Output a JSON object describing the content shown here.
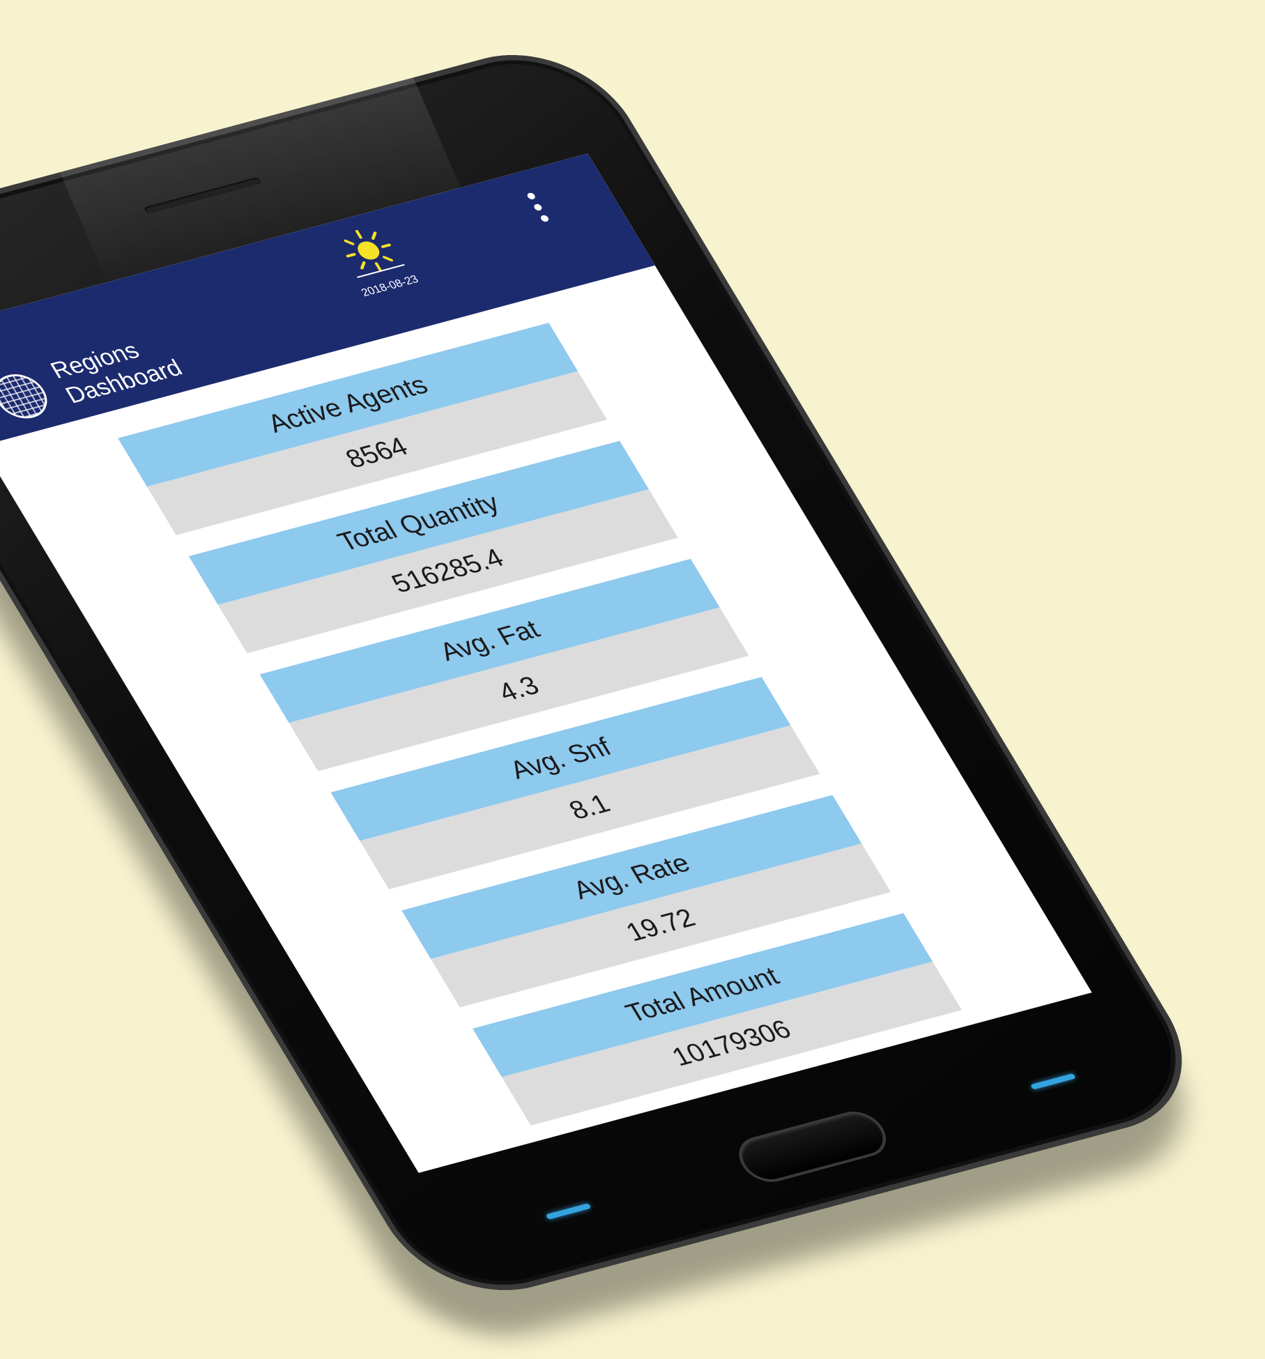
{
  "app": {
    "title_line1": "Regions",
    "title_line2": "Dashboard",
    "date": "2018-08-23",
    "weather_icon": "sun-icon",
    "menu_icon": "more-vert-icon",
    "colors": {
      "appbar": "#1c2b6e",
      "card_header": "#8ec9ee",
      "card_value": "#dcdcdc",
      "nav_key": "#34a4e0",
      "background": "#f8f3cf"
    }
  },
  "metrics": [
    {
      "label": "Active Agents",
      "value": "8564"
    },
    {
      "label": "Total Quantity",
      "value": "516285.4"
    },
    {
      "label": "Avg. Fat",
      "value": "4.3"
    },
    {
      "label": "Avg. Snf",
      "value": "8.1"
    },
    {
      "label": "Avg. Rate",
      "value": "19.72"
    },
    {
      "label": "Total Amount",
      "value": "10179306"
    }
  ]
}
